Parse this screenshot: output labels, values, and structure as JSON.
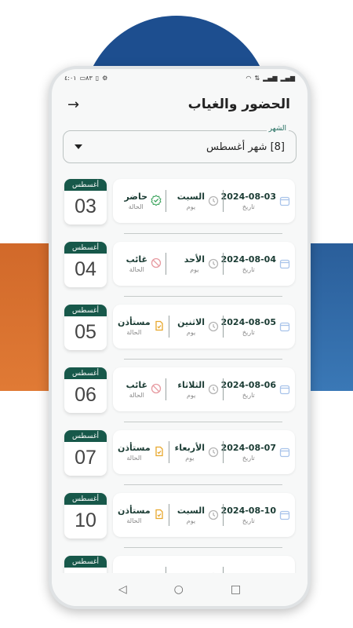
{
  "status_bar": {
    "time": "٤:٠١",
    "battery": "٨٣",
    "left_icons": [
      "battery-icon",
      "vibrate-icon",
      "settings-icon"
    ],
    "right_icons": [
      "wifi-icon",
      "data-speed-icon",
      "signal-icon",
      "signal-icon"
    ]
  },
  "header": {
    "title": "الحضور والغياب"
  },
  "month_filter": {
    "label": "الشهر",
    "value": "[8] شهر أغسطس"
  },
  "records": [
    {
      "month": "أغسطس",
      "day": "03",
      "date": "2024-08-03",
      "date_label": "تاريخ",
      "weekday": "السبت",
      "weekday_label": "يوم",
      "status": "حاضر",
      "status_label": "الحالة",
      "status_type": "present"
    },
    {
      "month": "أغسطس",
      "day": "04",
      "date": "2024-08-04",
      "date_label": "تاريخ",
      "weekday": "الأحد",
      "weekday_label": "يوم",
      "status": "غائب",
      "status_label": "الحالة",
      "status_type": "absent"
    },
    {
      "month": "أغسطس",
      "day": "05",
      "date": "2024-08-05",
      "date_label": "تاريخ",
      "weekday": "الاثنين",
      "weekday_label": "يوم",
      "status": "مستأذن",
      "status_label": "الحالة",
      "status_type": "excused"
    },
    {
      "month": "أغسطس",
      "day": "06",
      "date": "2024-08-06",
      "date_label": "تاريخ",
      "weekday": "الثلاثاء",
      "weekday_label": "يوم",
      "status": "غائب",
      "status_label": "الحالة",
      "status_type": "absent"
    },
    {
      "month": "أغسطس",
      "day": "07",
      "date": "2024-08-07",
      "date_label": "تاريخ",
      "weekday": "الأربعاء",
      "weekday_label": "يوم",
      "status": "مستأذن",
      "status_label": "الحالة",
      "status_type": "excused"
    },
    {
      "month": "أغسطس",
      "day": "10",
      "date": "2024-08-10",
      "date_label": "تاريخ",
      "weekday": "السبت",
      "weekday_label": "يوم",
      "status": "مستأذن",
      "status_label": "الحالة",
      "status_type": "excused"
    },
    {
      "month": "أغسطس",
      "day": "",
      "date": "",
      "date_label": "",
      "weekday": "",
      "weekday_label": "",
      "status": "",
      "status_label": "",
      "status_type": ""
    }
  ],
  "colors": {
    "accent": "#17584a",
    "present": "#3aa35c",
    "absent": "#e79aa0",
    "excused": "#e8a72c",
    "calendar_icon": "#a9c4ea",
    "clock_icon": "#b5b5b5"
  },
  "nav": {
    "icons": [
      "back-triangle-icon",
      "home-circle-icon",
      "recents-square-icon"
    ]
  }
}
